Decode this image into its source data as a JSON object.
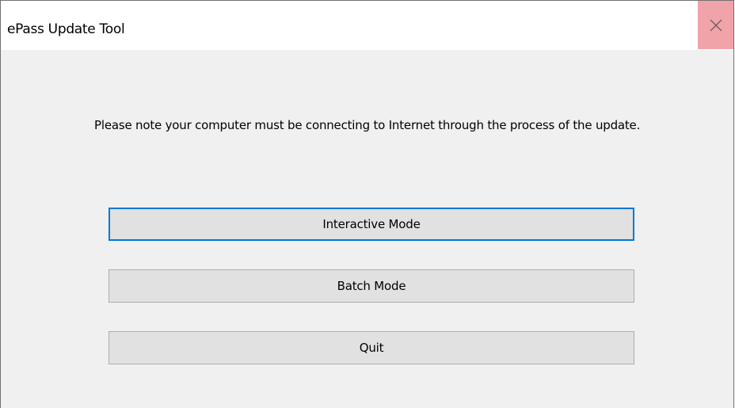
{
  "window": {
    "title": "ePass Update Tool",
    "close_icon": "close-icon"
  },
  "content": {
    "note": "Please note your computer must be connecting to Internet through the process of the update."
  },
  "buttons": {
    "interactive_label": "Interactive Mode",
    "batch_label": "Batch Mode",
    "quit_label": "Quit"
  },
  "colors": {
    "close_hover": "#f0a3a8",
    "focus_border": "#0078d7",
    "button_bg": "#e1e1e1",
    "window_bg": "#f0f0f0"
  }
}
